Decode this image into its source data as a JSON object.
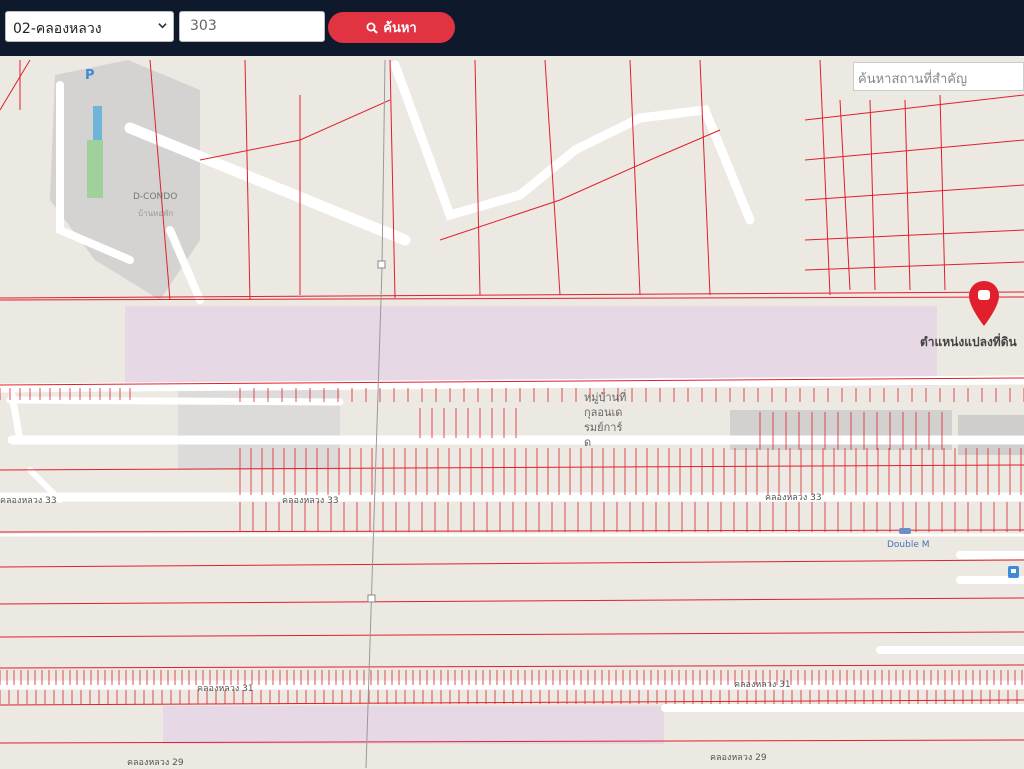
{
  "toolbar": {
    "district": "02-คลองหลวง",
    "parcel_number": "303",
    "search_label": "ค้นหา"
  },
  "map": {
    "place_search_placeholder": "ค้นหาสถานที่สำคัญ",
    "labels": {
      "condo": "D-CONDO",
      "condo_sub": "บ้านหอพัก",
      "marker_label": "ตำแหน่งแปลงที่ดิน",
      "village": [
        "หมู่บ้านที่",
        "กุลอนเด",
        "รมย์การ์",
        "ด"
      ],
      "road_33": "คลองหลวง 33",
      "road_31": "คลองหลวง 31",
      "road_29": "คลองหลวง 29",
      "poi": "Double M"
    }
  },
  "colors": {
    "topbar": "#0e1a2b",
    "accent": "#e23342",
    "parcel_line": "#e0202c"
  }
}
